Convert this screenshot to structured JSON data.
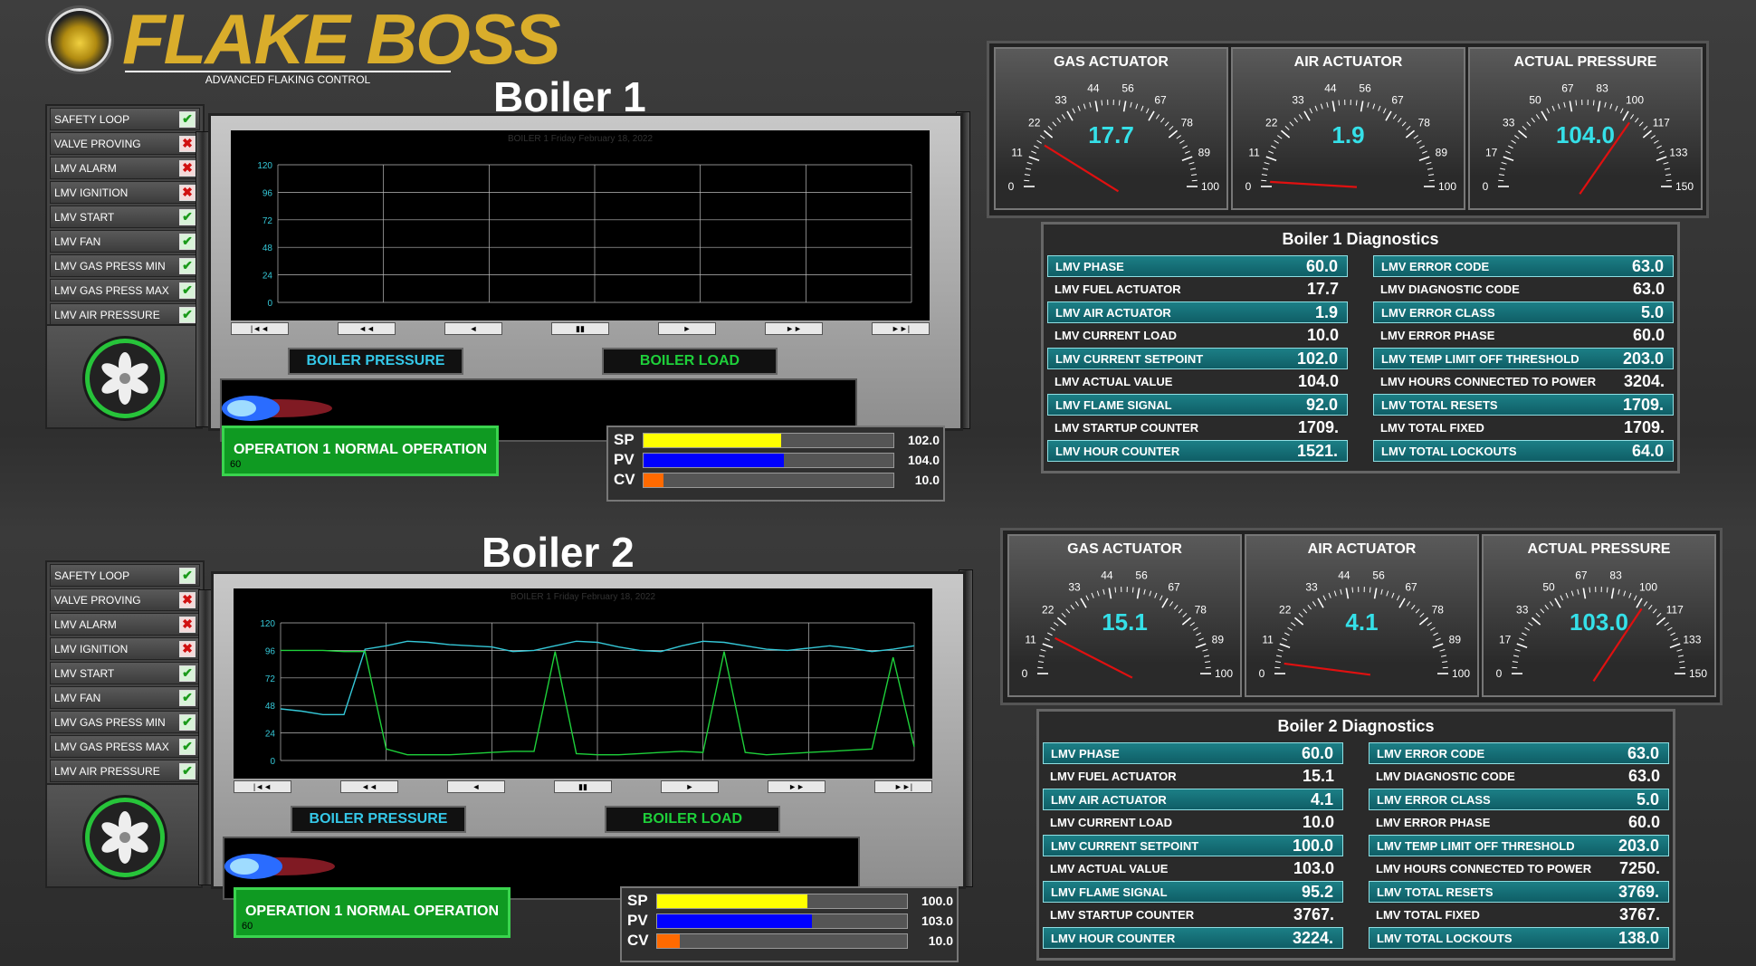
{
  "header": {
    "logo_text": "FLAKE BOSS",
    "logo_subtitle": "ADVANCED FLAKING CONTROL"
  },
  "boilers": [
    {
      "title": "Boiler 1",
      "status": [
        {
          "label": "SAFETY LOOP",
          "ok": true
        },
        {
          "label": "VALVE PROVING",
          "ok": false
        },
        {
          "label": "LMV ALARM",
          "ok": false
        },
        {
          "label": "LMV IGNITION",
          "ok": false
        },
        {
          "label": "LMV START",
          "ok": true
        },
        {
          "label": "LMV FAN",
          "ok": true
        },
        {
          "label": "LMV GAS PRESS MIN",
          "ok": true
        },
        {
          "label": "LMV GAS PRESS MAX",
          "ok": true
        },
        {
          "label": "LMV AIR PRESSURE",
          "ok": true
        }
      ],
      "chart_header": "BOILER 1     Friday February 18, 2022",
      "legend_pressure": "BOILER PRESSURE",
      "legend_load": "BOILER LOAD",
      "operation": "OPERATION 1  NORMAL OPERATION",
      "operation_num": "60",
      "bars": {
        "sp": {
          "label": "SP",
          "value": "102.0",
          "frac": 0.55
        },
        "pv": {
          "label": "PV",
          "value": "104.0",
          "frac": 0.56
        },
        "cv": {
          "label": "CV",
          "value": "10.0",
          "frac": 0.08
        }
      },
      "gauges": [
        {
          "title": "GAS ACTUATOR",
          "value": "17.7",
          "needle": 17.7,
          "max": 100,
          "ticks": [
            "0",
            "11",
            "22",
            "33",
            "44",
            "56",
            "67",
            "78",
            "89",
            "100"
          ]
        },
        {
          "title": "AIR ACTUATOR",
          "value": "1.9",
          "needle": 1.9,
          "max": 100,
          "ticks": [
            "0",
            "11",
            "22",
            "33",
            "44",
            "56",
            "67",
            "78",
            "89",
            "100"
          ]
        },
        {
          "title": "ACTUAL PRESSURE",
          "value": "104.0",
          "needle": 104.0,
          "max": 150,
          "ticks": [
            "0",
            "17",
            "33",
            "50",
            "67",
            "83",
            "100",
            "117",
            "133",
            "150"
          ]
        }
      ],
      "diag_title": "Boiler 1 Diagnostics",
      "diag_left": [
        {
          "label": "LMV PHASE",
          "value": "60.0"
        },
        {
          "label": "LMV FUEL ACTUATOR",
          "value": "17.7"
        },
        {
          "label": "LMV AIR ACTUATOR",
          "value": "1.9"
        },
        {
          "label": "LMV CURRENT LOAD",
          "value": "10.0"
        },
        {
          "label": "LMV CURRENT SETPOINT",
          "value": "102.0"
        },
        {
          "label": "LMV ACTUAL VALUE",
          "value": "104.0"
        },
        {
          "label": "LMV FLAME SIGNAL",
          "value": "92.0"
        },
        {
          "label": "LMV STARTUP COUNTER",
          "value": "1709."
        },
        {
          "label": "LMV HOUR COUNTER",
          "value": "1521."
        }
      ],
      "diag_right": [
        {
          "label": "LMV ERROR CODE",
          "value": "63.0"
        },
        {
          "label": "LMV DIAGNOSTIC CODE",
          "value": "63.0"
        },
        {
          "label": "LMV ERROR CLASS",
          "value": "5.0"
        },
        {
          "label": "LMV ERROR PHASE",
          "value": "60.0"
        },
        {
          "label": "LMV TEMP LIMIT OFF THRESHOLD",
          "value": "203.0"
        },
        {
          "label": "LMV HOURS CONNECTED TO POWER",
          "value": "3204."
        },
        {
          "label": "LMV TOTAL RESETS",
          "value": "1709."
        },
        {
          "label": "LMV TOTAL FIXED",
          "value": "1709."
        },
        {
          "label": "LMV TOTAL LOCKOUTS",
          "value": "64.0"
        }
      ]
    },
    {
      "title": "Boiler 2",
      "status": [
        {
          "label": "SAFETY LOOP",
          "ok": true
        },
        {
          "label": "VALVE PROVING",
          "ok": false
        },
        {
          "label": "LMV ALARM",
          "ok": false
        },
        {
          "label": "LMV IGNITION",
          "ok": false
        },
        {
          "label": "LMV START",
          "ok": true
        },
        {
          "label": "LMV FAN",
          "ok": true
        },
        {
          "label": "LMV GAS PRESS MIN",
          "ok": true
        },
        {
          "label": "LMV GAS PRESS MAX",
          "ok": true
        },
        {
          "label": "LMV AIR PRESSURE",
          "ok": true
        }
      ],
      "chart_header": "BOILER 1     Friday February 18, 2022",
      "legend_pressure": "BOILER PRESSURE",
      "legend_load": "BOILER LOAD",
      "operation": "OPERATION 1  NORMAL OPERATION",
      "operation_num": "60",
      "bars": {
        "sp": {
          "label": "SP",
          "value": "100.0",
          "frac": 0.6
        },
        "pv": {
          "label": "PV",
          "value": "103.0",
          "frac": 0.62
        },
        "cv": {
          "label": "CV",
          "value": "10.0",
          "frac": 0.09
        }
      },
      "gauges": [
        {
          "title": "GAS ACTUATOR",
          "value": "15.1",
          "needle": 15.1,
          "max": 100,
          "ticks": [
            "0",
            "11",
            "22",
            "33",
            "44",
            "56",
            "67",
            "78",
            "89",
            "100"
          ]
        },
        {
          "title": "AIR ACTUATOR",
          "value": "4.1",
          "needle": 4.1,
          "max": 100,
          "ticks": [
            "0",
            "11",
            "22",
            "33",
            "44",
            "56",
            "67",
            "78",
            "89",
            "100"
          ]
        },
        {
          "title": "ACTUAL PRESSURE",
          "value": "103.0",
          "needle": 103.0,
          "max": 150,
          "ticks": [
            "0",
            "17",
            "33",
            "50",
            "67",
            "83",
            "100",
            "117",
            "133",
            "150"
          ]
        }
      ],
      "diag_title": "Boiler 2 Diagnostics",
      "diag_left": [
        {
          "label": "LMV PHASE",
          "value": "60.0"
        },
        {
          "label": "LMV FUEL ACTUATOR",
          "value": "15.1"
        },
        {
          "label": "LMV AIR ACTUATOR",
          "value": "4.1"
        },
        {
          "label": "LMV CURRENT LOAD",
          "value": "10.0"
        },
        {
          "label": "LMV CURRENT SETPOINT",
          "value": "100.0"
        },
        {
          "label": "LMV ACTUAL VALUE",
          "value": "103.0"
        },
        {
          "label": "LMV FLAME SIGNAL",
          "value": "95.2"
        },
        {
          "label": "LMV STARTUP COUNTER",
          "value": "3767."
        },
        {
          "label": "LMV HOUR COUNTER",
          "value": "3224."
        }
      ],
      "diag_right": [
        {
          "label": "LMV ERROR CODE",
          "value": "63.0"
        },
        {
          "label": "LMV DIAGNOSTIC CODE",
          "value": "63.0"
        },
        {
          "label": "LMV ERROR CLASS",
          "value": "5.0"
        },
        {
          "label": "LMV ERROR PHASE",
          "value": "60.0"
        },
        {
          "label": "LMV TEMP LIMIT OFF THRESHOLD",
          "value": "203.0"
        },
        {
          "label": "LMV HOURS CONNECTED TO POWER",
          "value": "7250."
        },
        {
          "label": "LMV TOTAL RESETS",
          "value": "3769."
        },
        {
          "label": "LMV TOTAL FIXED",
          "value": "3767."
        },
        {
          "label": "LMV TOTAL LOCKOUTS",
          "value": "138.0"
        }
      ]
    }
  ],
  "trend_axis": {
    "yticks": [
      "120",
      "96",
      "72",
      "48",
      "24",
      "0"
    ],
    "ylim": [
      0,
      120
    ]
  },
  "nav_buttons": [
    "|◄◄",
    "◄◄",
    "◄",
    "▮▮",
    "►",
    "►►",
    "►►|"
  ],
  "colors": {
    "teal": "#35e0e8",
    "green_ok": "#27c43a",
    "sp": "#ffff00",
    "pv": "#0000ff",
    "cv": "#ff6a00"
  },
  "chart_data": [
    {
      "type": "line",
      "title": "BOILER 1",
      "xlabel": "",
      "ylabel": "",
      "ylim": [
        0,
        120
      ],
      "series": []
    },
    {
      "type": "line",
      "title": "BOILER 1",
      "xlabel": "",
      "ylabel": "",
      "ylim": [
        0,
        120
      ],
      "series": [
        {
          "name": "BOILER PRESSURE",
          "color": "#35c8d8",
          "values": [
            45,
            43,
            40,
            40,
            97,
            100,
            104,
            103,
            101,
            100,
            99,
            95,
            96,
            100,
            104,
            103,
            99,
            96,
            95,
            100,
            104,
            103,
            100,
            97,
            96,
            98,
            100,
            98,
            95,
            97,
            100
          ]
        },
        {
          "name": "BOILER LOAD",
          "color": "#1ed03a",
          "values": [
            96,
            96,
            96,
            95,
            95,
            10,
            5,
            5,
            5,
            6,
            7,
            8,
            8,
            95,
            6,
            5,
            5,
            6,
            7,
            8,
            7,
            95,
            7,
            5,
            6,
            7,
            8,
            9,
            10,
            90,
            12
          ]
        }
      ]
    }
  ]
}
